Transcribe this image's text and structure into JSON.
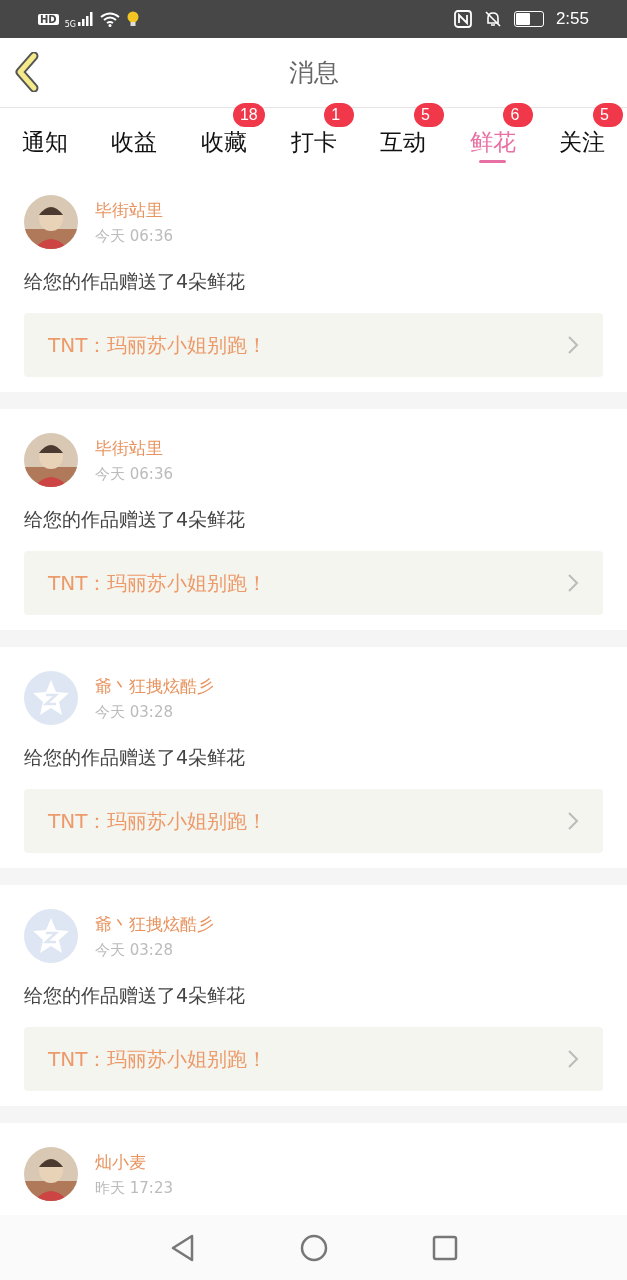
{
  "status_bar": {
    "hd_label": "HD",
    "network_label": "5G",
    "time": "2:55"
  },
  "header": {
    "title": "消息"
  },
  "tabs": [
    {
      "label": "通知",
      "selected": false
    },
    {
      "label": "收益",
      "selected": false
    },
    {
      "label": "收藏",
      "badge": "18",
      "selected": false
    },
    {
      "label": "打卡",
      "badge": "1",
      "selected": false
    },
    {
      "label": "互动",
      "badge": "5",
      "selected": false
    },
    {
      "label": "鲜花",
      "badge": "6",
      "selected": true
    },
    {
      "label": "关注",
      "badge": "5",
      "selected": false
    }
  ],
  "messages": [
    {
      "name": "毕街站里",
      "time": "今天 06:36",
      "text": "给您的作品赠送了4朵鲜花",
      "work": "TNT：玛丽苏小姐别跑！"
    },
    {
      "name": "毕街站里",
      "time": "今天 06:36",
      "text": "给您的作品赠送了4朵鲜花",
      "work": "TNT：玛丽苏小姐别跑！"
    },
    {
      "avatar": {
        "kind": "default"
      },
      "name": "爺丶狂拽炫酷彡",
      "time": "今天 03:28",
      "text": "给您的作品赠送了4朵鲜花",
      "work": "TNT：玛丽苏小姐别跑！"
    },
    {
      "avatar": {
        "kind": "default"
      },
      "name": "爺丶狂拽炫酷彡",
      "time": "今天 03:28",
      "text": "给您的作品赠送了4朵鲜花",
      "work": "TNT：玛丽苏小姐别跑！"
    },
    {
      "name": "灿小麦",
      "time": "昨天 17:23"
    }
  ]
}
